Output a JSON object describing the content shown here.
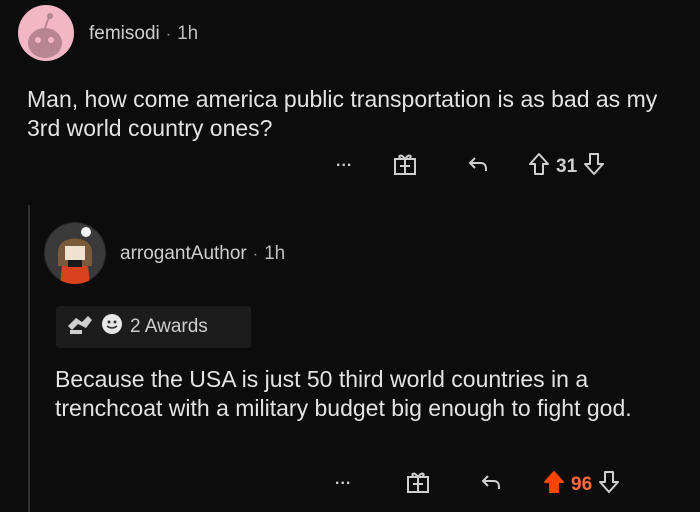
{
  "post": {
    "username": "femisodi",
    "separator": "·",
    "time": "1h",
    "text": "Man, how come america public transportation is as bad as my 3rd world country ones?",
    "more_label": "...",
    "score": "31"
  },
  "reply": {
    "username": "arrogantAuthor",
    "separator": "·",
    "time": "1h",
    "awards": "2 Awards",
    "text": "Because the USA is just 50 third world countries in a trenchcoat with a military budget big enough to fight god.",
    "more_label": "...",
    "score": "96"
  },
  "colors": {
    "background": "#0c0c0c",
    "upvote_active": "#ff4500",
    "score_active": "#ff6b3d",
    "avatar_pink": "#f2b6c4"
  },
  "icons": [
    "more-icon",
    "gift-icon",
    "reply-icon",
    "upvote-icon",
    "downvote-icon"
  ]
}
